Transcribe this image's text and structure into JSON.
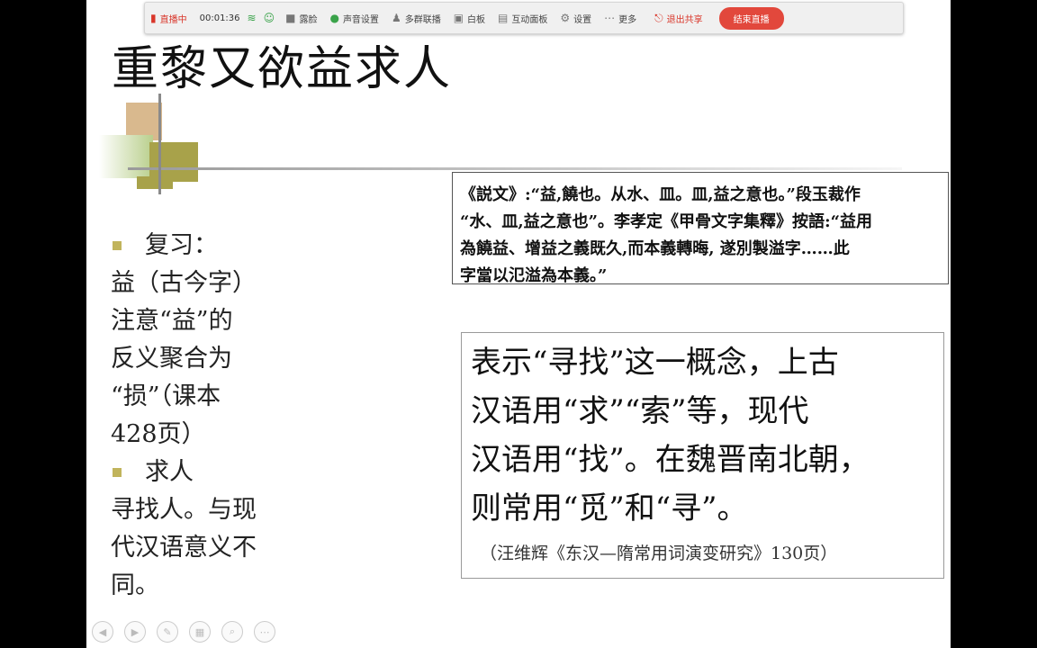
{
  "toolbar": {
    "live_status": "直播中",
    "timer": "00:01:36",
    "items": [
      {
        "label": "露脸",
        "icon": "camera-icon"
      },
      {
        "label": "声音设置",
        "icon": "microphone-icon"
      },
      {
        "label": "多群联播",
        "icon": "users-icon"
      },
      {
        "label": "白板",
        "icon": "whiteboard-icon"
      },
      {
        "label": "互动面板",
        "icon": "chat-icon"
      },
      {
        "label": "设置",
        "icon": "gear-icon"
      },
      {
        "label": "更多",
        "icon": "more-icon"
      },
      {
        "label": "退出共享",
        "icon": "exit-icon"
      }
    ],
    "end_button": "结束直播",
    "accent": "#e2483c"
  },
  "slide": {
    "title": "重黎又欲益求人",
    "left": {
      "bullet1": "复习：",
      "para1": [
        "益（古今字）",
        "注意“益”的",
        "反义聚合为",
        "“损”（课本",
        "428页）"
      ],
      "bullet2": "求人",
      "para2": [
        "寻找人。与现",
        "代汉语意义不",
        "同。"
      ]
    },
    "quote_lines": [
      "《説文》:“益,饒也。从水、皿。皿,益之意也。”段玉裁作",
      "“水、皿,益之意也”。李孝定《甲骨文字集釋》按語:“益用",
      "為饒益、增益之義既久,而本義轉晦, 遂別製溢字……此",
      "字當以氾溢為本義。”"
    ],
    "main_lines": [
      "表示“寻找”这一概念，上古",
      "汉语用“求”“索”等，现代",
      "汉语用“找”。在魏晋南北朝，",
      "则常用“觅”和“寻”。"
    ],
    "citation": "（汪维辉《东汉—隋常用词演变研究》130页）"
  }
}
